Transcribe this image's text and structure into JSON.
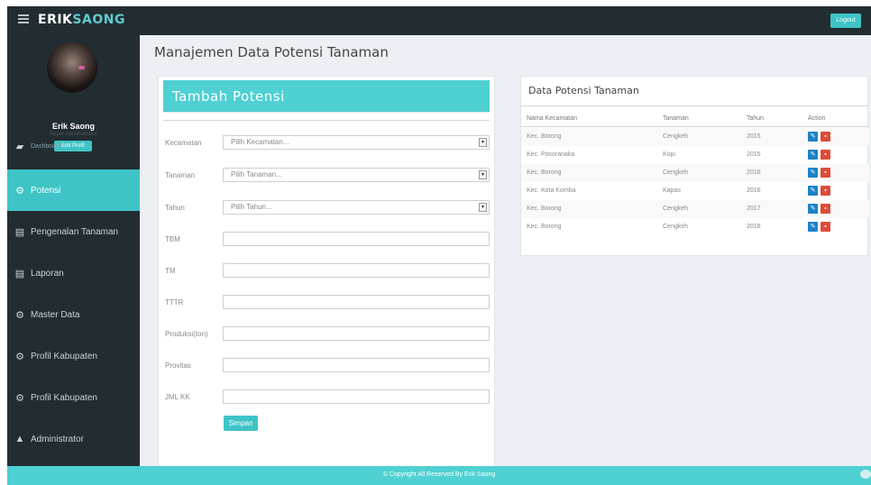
{
  "header": {
    "brand_part1": "ERIK",
    "brand_part2": "SAONG",
    "logout_label": "Logout"
  },
  "sidebar": {
    "user_name": "Erik Saong",
    "user_role": "Super Administrator",
    "edit_profile_label": "Edit Profil",
    "items": [
      {
        "label": "Dashboard",
        "icon": "dashboard-icon"
      },
      {
        "label": "Potensi",
        "icon": "cogs-icon"
      },
      {
        "label": "Pengenalan Tanaman",
        "icon": "book-icon"
      },
      {
        "label": "Laporan",
        "icon": "book-icon"
      },
      {
        "label": "Master Data",
        "icon": "cogs-icon"
      },
      {
        "label": "Profil Kabupaten",
        "icon": "cogs-icon"
      },
      {
        "label": "Profil Kabupaten",
        "icon": "cogs-icon"
      },
      {
        "label": "Administrator",
        "icon": "user-icon"
      }
    ]
  },
  "main": {
    "page_title": "Manajemen Data Potensi Tanaman",
    "form": {
      "title": "Tambah Potensi",
      "kecamatan_label": "Kecamatan",
      "kecamatan_value": "Pilih Kecamatan...",
      "tanaman_label": "Tanaman",
      "tanaman_value": "Pilih Tanaman...",
      "tahun_label": "Tahun",
      "tahun_value": "Pilih Tahun...",
      "tbm_label": "TBM",
      "tm_label": "TM",
      "ttr_label": "TTTR",
      "produksi_label": "Produksi(ton)",
      "provitas_label": "Provitas",
      "jml_kk_label": "JML KK",
      "save_label": "Simpan"
    },
    "table": {
      "title": "Data Potensi Tanaman",
      "columns": [
        "Nama Kecamatan",
        "Tanaman",
        "Tahun",
        "Action"
      ],
      "rows": [
        [
          "Kec. Borong",
          "Cengkeh",
          "2015"
        ],
        [
          "Kec. Pocoranaka",
          "Kopi",
          "2015"
        ],
        [
          "Kec. Borong",
          "Cengkeh",
          "2016"
        ],
        [
          "Kec. Kota Komba",
          "Kapas",
          "2016"
        ],
        [
          "Kec. Borong",
          "Cengkeh",
          "2017"
        ],
        [
          "Kec. Borong",
          "Cengkeh",
          "2018"
        ]
      ]
    }
  },
  "footer": {
    "copyright": "© Copyright All Reserved By Erik Saong"
  },
  "colors": {
    "accent": "#3ec4c6",
    "sidebar_bg": "#222d32",
    "edit_button": "#1e82c8",
    "delete_button": "#dd4b39"
  }
}
